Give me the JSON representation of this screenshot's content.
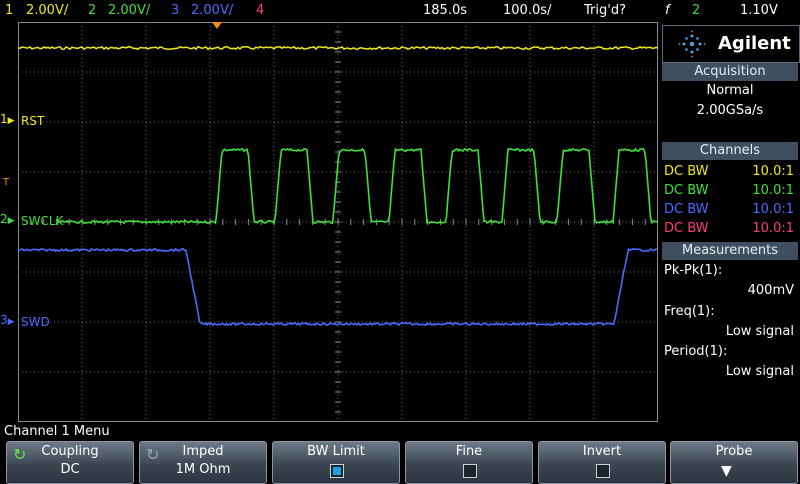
{
  "topbar": {
    "ch1_num": "1",
    "ch1_scale": "2.00V/",
    "ch2_num": "2",
    "ch2_scale": "2.00V/",
    "ch3_num": "3",
    "ch3_scale": "2.00V/",
    "ch4_num": "4",
    "time_delay": "185.0s",
    "time_scale": "100.0s/",
    "trigger_status": "Trig'd?",
    "trigger_slope": "f",
    "trigger_source": "2",
    "trigger_level": "1.10V"
  },
  "colors": {
    "ch1": "#f2e81a",
    "ch2": "#3fe03a",
    "ch3": "#4a6bff",
    "ch4": "#ff3b7a",
    "grid": "#8b8b8b",
    "panel_title": "#3f4f5f",
    "trigger": "#f58a1f"
  },
  "screen": {
    "labels": {
      "rst": "RST",
      "swclk": "SWCLK",
      "swd": "SWD",
      "ch1_marker": "1",
      "ch2_marker": "2",
      "ch3_marker": "3",
      "trigger_marker": "T"
    }
  },
  "panel": {
    "brand": "Agilent",
    "acquisition_title": "Acquisition",
    "acq_mode": "Normal",
    "acq_rate": "2.00GSa/s",
    "channels_title": "Channels",
    "channels": [
      {
        "coupling": "DC BW",
        "probe": "10.0:1"
      },
      {
        "coupling": "DC BW",
        "probe": "10.0:1"
      },
      {
        "coupling": "DC BW",
        "probe": "10.0:1"
      },
      {
        "coupling": "DC BW",
        "probe": "10.0:1"
      }
    ],
    "measurements_title": "Measurements",
    "measurements": [
      {
        "label": "Pk-Pk(1):",
        "value": "400mV"
      },
      {
        "label": "Freq(1):",
        "value": "Low signal"
      },
      {
        "label": "Period(1):",
        "value": "Low signal"
      }
    ]
  },
  "menu": {
    "title": "Channel 1 Menu",
    "softkeys": [
      {
        "label": "Coupling",
        "value": "DC"
      },
      {
        "label": "Imped",
        "value": "1M Ohm"
      },
      {
        "label": "BW Limit",
        "checked": true
      },
      {
        "label": "Fine",
        "checked": false
      },
      {
        "label": "Invert",
        "checked": false
      },
      {
        "label": "Probe"
      }
    ]
  }
}
